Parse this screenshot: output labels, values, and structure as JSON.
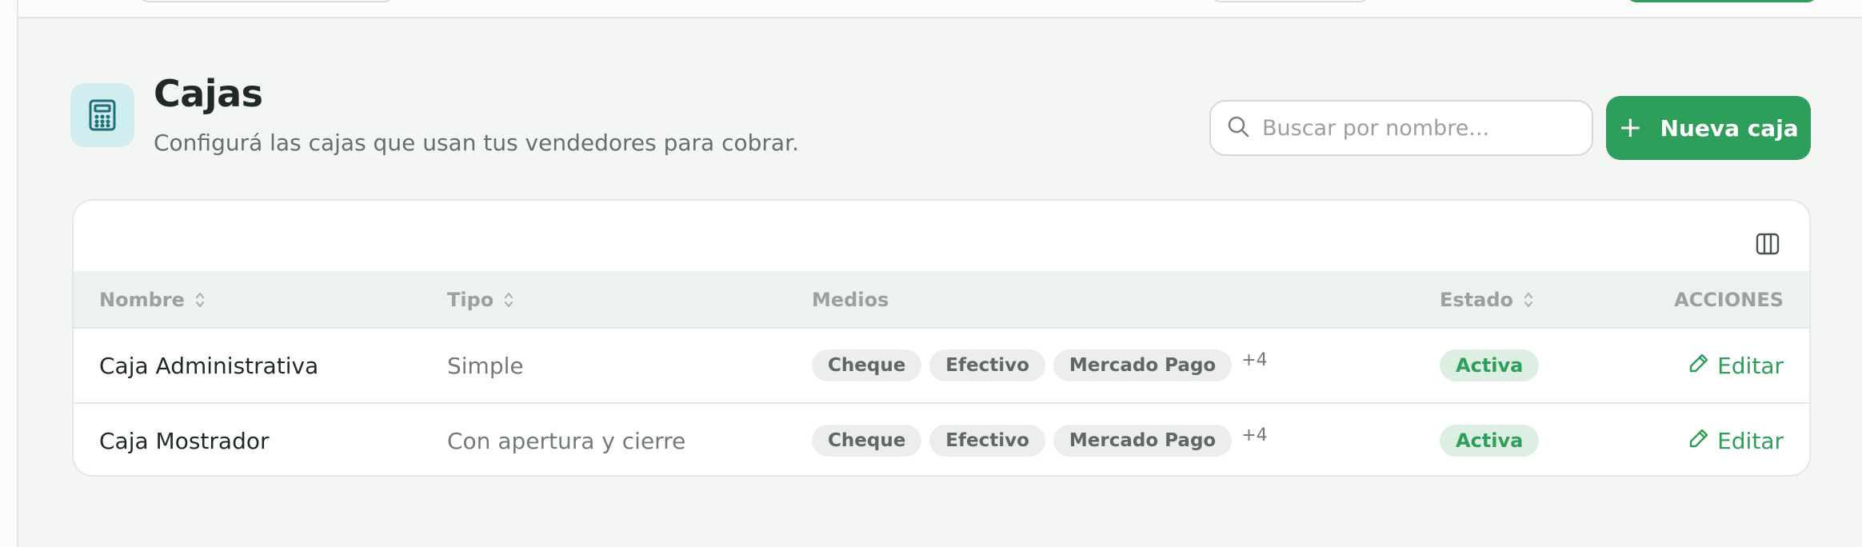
{
  "header": {
    "title": "Cajas",
    "subtitle": "Configurá las cajas que usan tus vendedores para cobrar.",
    "icon": "calculator-icon"
  },
  "search": {
    "placeholder": "Buscar por nombre...",
    "value": ""
  },
  "actions": {
    "new_label": "Nueva caja"
  },
  "table": {
    "columns": {
      "name": "Nombre",
      "type": "Tipo",
      "methods": "Medios",
      "status": "Estado",
      "actions": "ACCIONES"
    },
    "rows": [
      {
        "name": "Caja Administrativa",
        "type": "Simple",
        "methods": [
          "Cheque",
          "Efectivo",
          "Mercado Pago"
        ],
        "more": "+4",
        "status": "Activa",
        "action": "Editar"
      },
      {
        "name": "Caja Mostrador",
        "type": "Con apertura y cierre",
        "methods": [
          "Cheque",
          "Efectivo",
          "Mercado Pago"
        ],
        "more": "+4",
        "status": "Activa",
        "action": "Editar"
      }
    ]
  },
  "colors": {
    "accent": "#2e9e5b",
    "background": "#f4f6f3",
    "icon_bg": "#cfecef",
    "status_bg": "#dcefe2"
  }
}
